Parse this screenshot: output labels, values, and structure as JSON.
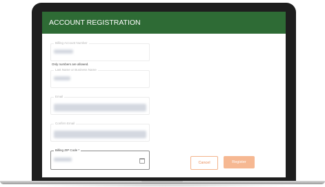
{
  "header": {
    "title": "ACCOUNT REGISTRATION"
  },
  "form": {
    "billing_account": {
      "label": "Billing Account Number"
    },
    "billing_helper": "Only numbers are allowed.",
    "last_name": {
      "label": "Last Name or Business Name"
    },
    "email": {
      "label": "Email"
    },
    "confirm_email": {
      "label": "Confirm Email"
    },
    "zip": {
      "label": "Billing ZIP Code *"
    }
  },
  "actions": {
    "cancel_label": "Cancel",
    "register_label": "Register"
  },
  "colors": {
    "header_green": "#2e6b35",
    "accent_orange": "#f6b892"
  }
}
